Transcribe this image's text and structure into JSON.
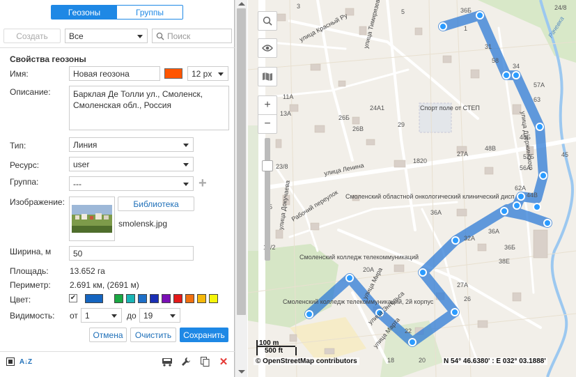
{
  "tabs": [
    {
      "label": "Геозоны",
      "active": true
    },
    {
      "label": "Группы",
      "active": false
    }
  ],
  "toolbar": {
    "create_label": "Создать",
    "filter_value": "Все",
    "search_placeholder": "Поиск"
  },
  "section_title": "Свойства геозоны",
  "form": {
    "name_label": "Имя:",
    "name_value": "Новая геозона",
    "name_color": "#ff5500",
    "font_size": "12 px",
    "description_label": "Описание:",
    "description_value": "Барклая Де Толли ул., Смоленск, Смоленская обл., Россия",
    "type_label": "Тип:",
    "type_value": "Линия",
    "resource_label": "Ресурс:",
    "resource_value": "user",
    "group_label": "Группа:",
    "group_value": "---",
    "image_label": "Изображение:",
    "library_button": "Библиотека",
    "image_filename": "smolensk.jpg",
    "width_label": "Ширина, м",
    "width_value": "50",
    "area_label": "Площадь:",
    "area_value": "13.652 га",
    "perimeter_label": "Периметр:",
    "perimeter_value": "2.691 км, (2691 м)",
    "color_label": "Цвет:",
    "color_value": "#1565c0",
    "palette": [
      "#1565c0",
      "#1aa843",
      "#1ab5b5",
      "#1e6fc8",
      "#1a2fb5",
      "#7a0fb5",
      "#e41a1a",
      "#f07010",
      "#f5b80a",
      "#f5f50a"
    ],
    "visibility_label": "Видимость:",
    "from_label": "от",
    "from_value": "1",
    "to_label": "до",
    "to_value": "19"
  },
  "actions": {
    "cancel": "Отмена",
    "clear": "Очистить",
    "save": "Сохранить"
  },
  "map": {
    "scale_metric": "100 m",
    "scale_imperial": "500 ft",
    "attribution": "© OpenStreetMap contributors",
    "coordinates": "N 54° 46.6380' : E 032° 03.1888'",
    "route_color": "#2e7bd6",
    "labels": [
      {
        "text": "улица Красный Ру"
      },
      {
        "text": "улица Тимирязева"
      },
      {
        "text": "Спорт поле от СТЕП"
      },
      {
        "text": "улица Ленина"
      },
      {
        "text": "Рабочий переулок"
      },
      {
        "text": "Смоленский областной онкологический клинический дисп"
      },
      {
        "text": "Смоленский колледж телекоммуникаций"
      },
      {
        "text": "Смоленский колледж телекоммуникаций, 2й корпус"
      },
      {
        "text": "улица Мира"
      },
      {
        "text": "улица Энгельса"
      },
      {
        "text": "улица Марта"
      },
      {
        "text": "Рачевка"
      },
      {
        "text": "улица Дзержинского"
      },
      {
        "text": "улица Докучаева"
      }
    ]
  }
}
